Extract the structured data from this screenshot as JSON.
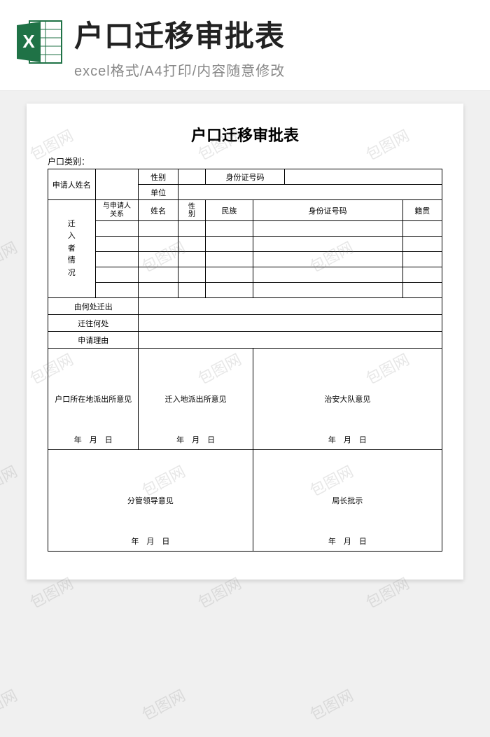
{
  "header": {
    "main_title": "户口迁移审批表",
    "subtitle": "excel格式/A4打印/内容随意修改",
    "icon_name": "excel-icon"
  },
  "form": {
    "title": "户口迁移审批表",
    "hukou_type_label": "户口类别：",
    "applicant_name_label": "申请人姓名",
    "gender_label": "性别",
    "id_number_label": "身份证号码",
    "unit_label": "单位",
    "movers_section_label": "迁\n入\n者\n情\n况",
    "relation_label": "与申请人\n关系",
    "name_label": "姓名",
    "gender2_label": "性\n别",
    "ethnicity_label": "民族",
    "id2_label": "身份证号码",
    "origin_label": "籍贯",
    "move_from_label": "由何处迁出",
    "move_to_label": "迁往何处",
    "reason_label": "申请理由",
    "opinion1_label": "户口所在地派出所意见",
    "opinion2_label": "迁入地派出所意见",
    "opinion3_label": "治安大队意见",
    "opinion4_label": "分管领导意见",
    "opinion5_label": "局长批示",
    "date_text": "年　月　日"
  },
  "watermark": "包图网"
}
